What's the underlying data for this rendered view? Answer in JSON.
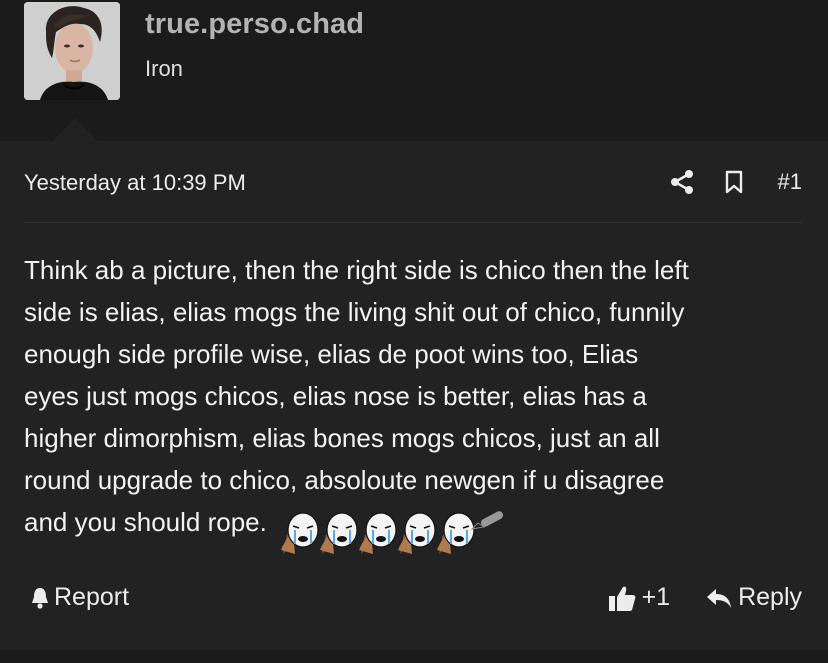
{
  "user": {
    "name": "true.perso.chad",
    "title": "Iron"
  },
  "post": {
    "timestamp": "Yesterday at 10:39 PM",
    "number": "#1",
    "lines": [
      "Think ab a picture, then the right side is chico then the left",
      "side is elias, elias mogs the living shit out of chico, funnily",
      "enough side profile wise, elias de poot wins too, Elias",
      "eyes just mogs chicos, elias nose is better, elias has a",
      "higher dimorphism, elias bones mogs chicos, just an all",
      "round upgrade to chico, absoloute newgen if u disagree",
      "and you should rope."
    ],
    "emojis": [
      "crying-wojak-emoji",
      "crying-wojak-emoji",
      "crying-wojak-emoji",
      "crying-wojak-emoji",
      "crying-wojak-emoji"
    ],
    "trailing_icon": "pen-icon"
  },
  "actions": {
    "report_label": "Report",
    "like_count": "+1",
    "reply_label": "Reply"
  },
  "icons": {
    "share": "share-icon",
    "bookmark": "bookmark-icon",
    "report": "bell-icon",
    "like": "thumbs-up-icon",
    "reply": "reply-arrow-icon"
  },
  "colors": {
    "background": "#1b1b1b",
    "card": "#222222",
    "username": "#b3b3b3",
    "text": "#f2f2f2"
  }
}
